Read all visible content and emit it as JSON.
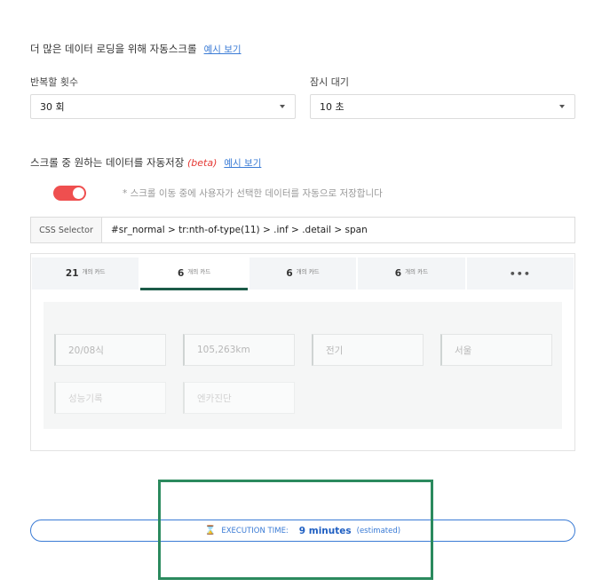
{
  "autoscroll": {
    "title": "더 많은 데이터 로딩을 위해 자동스크롤",
    "example_link": "예시 보기",
    "repeat_label": "반복할 횟수",
    "repeat_value": "30 회",
    "wait_label": "잠시 대기",
    "wait_value": "10 초"
  },
  "autosave": {
    "title": "스크롤 중 원하는 데이터를 자동저장",
    "beta": "(beta)",
    "example_link": "예시 보기",
    "toggle_on": true,
    "hint": "* 스크롤 이동 중에 사용자가 선택한 데이터를 자동으로 저장합니다"
  },
  "selector": {
    "label": "CSS Selector",
    "value": "#sr_normal > tr:nth-of-type(11) > .inf > .detail > span"
  },
  "tabs": [
    {
      "num": "21",
      "unit": "개의 카드"
    },
    {
      "num": "6",
      "unit": "개의 카드"
    },
    {
      "num": "6",
      "unit": "개의 카드"
    },
    {
      "num": "6",
      "unit": "개의 카드"
    }
  ],
  "tab_more": "•••",
  "chips": [
    "20/08식",
    "105,263km",
    "전기",
    "서울",
    "성능기록",
    "엔카진단"
  ],
  "execution": {
    "label": "EXECUTION TIME:",
    "value": "9 minutes",
    "note": "(estimated)"
  },
  "colors": {
    "accent": "#3a7bd5",
    "toggle": "#ef4f4f",
    "active_tab": "#1c5b48",
    "highlight": "#2b8a5e"
  },
  "icons": {
    "exec": "hourglass-icon",
    "dropdown": "caret-down-icon"
  }
}
